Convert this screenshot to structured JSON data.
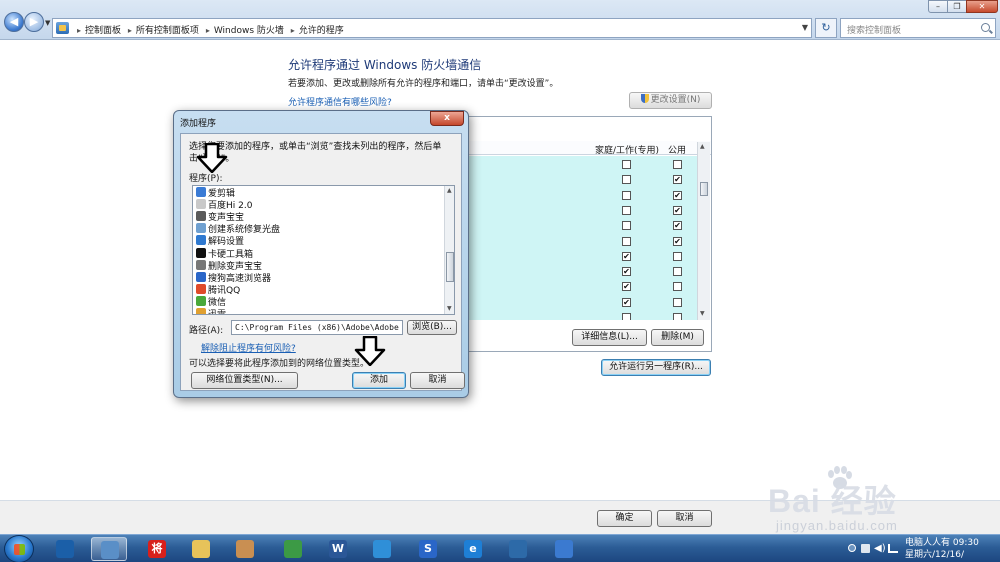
{
  "address_bar": {
    "crumbs": [
      "控制面板",
      "所有控制面板项",
      "Windows 防火墙",
      "允许的程序"
    ],
    "search_placeholder": "搜索控制面板"
  },
  "main": {
    "title": "允许程序通过 Windows 防火墙通信",
    "description": "若要添加、更改或删除所有允许的程序和端口，请单击“更改设置”。",
    "risk_link": "允许程序通信有哪些风险?",
    "change_settings_label": "更改设置(N)",
    "columns": {
      "home_work": "家庭/工作(专用)",
      "public": "公用"
    },
    "rows": [
      {
        "home": false,
        "public": false
      },
      {
        "home": false,
        "public": true
      },
      {
        "home": false,
        "public": true
      },
      {
        "home": false,
        "public": true
      },
      {
        "home": false,
        "public": true
      },
      {
        "home": false,
        "public": true
      },
      {
        "home": true,
        "public": false
      },
      {
        "home": true,
        "public": false
      },
      {
        "home": true,
        "public": false
      },
      {
        "home": true,
        "public": false
      },
      {
        "home": false,
        "public": false
      }
    ],
    "details_label": "详细信息(L)...",
    "delete_label": "删除(M)",
    "allow_other_label": "允许运行另一程序(R)..."
  },
  "dialog": {
    "title": "添加程序",
    "close_symbol": "x",
    "instruction": "选择您要添加的程序，或单击“浏览”查找未列出的程序，然后单击“确定”。",
    "programs_label": "程序(P):",
    "programs": [
      {
        "name": "爱剪辑",
        "icon_color": "#3a7bd5"
      },
      {
        "name": "百度Hi 2.0",
        "icon_color": "#c9c9c9"
      },
      {
        "name": "变声宝宝",
        "icon_color": "#5a5a5a"
      },
      {
        "name": "创建系统修复光盘",
        "icon_color": "#6fa0d0"
      },
      {
        "name": "解码设置",
        "icon_color": "#2f79d0"
      },
      {
        "name": "卡硬工具箱",
        "icon_color": "#111111"
      },
      {
        "name": "删除变声宝宝",
        "icon_color": "#777777"
      },
      {
        "name": "搜狗高速浏览器",
        "icon_color": "#2a66c8"
      },
      {
        "name": "腾讯QQ",
        "icon_color": "#e04b2a"
      },
      {
        "name": "微信",
        "icon_color": "#4aa83a"
      },
      {
        "name": "迅雷",
        "icon_color": "#e0a030"
      }
    ],
    "path_label": "路径(A):",
    "path_value": "C:\\Program Files (x86)\\Adobe\\Adobe Cr",
    "browse_label": "浏览(B)...",
    "block_risk_link": "解除阻止程序有何风险?",
    "network_desc": "可以选择要将此程序添加到的网络位置类型。",
    "network_type_label": "网络位置类型(N)...",
    "add_label": "添加",
    "cancel_label": "取消"
  },
  "footer": {
    "ok_label": "确定",
    "cancel_label": "取消"
  },
  "taskbar": {
    "items": [
      {
        "name": "show-desktop",
        "glyph": "",
        "color": "#1b5fa8"
      },
      {
        "name": "control-panel",
        "glyph": "",
        "color": "#5a8fc7",
        "active": true
      },
      {
        "name": "app-jiang",
        "glyph": "将",
        "color": "#d8201c"
      },
      {
        "name": "folder",
        "glyph": "",
        "color": "#e7c35a"
      },
      {
        "name": "paint",
        "glyph": "",
        "color": "#c98f52"
      },
      {
        "name": "chrome",
        "glyph": "",
        "color": "#3c9a45"
      },
      {
        "name": "word",
        "glyph": "W",
        "color": "#2b5797"
      },
      {
        "name": "app-blue",
        "glyph": "",
        "color": "#2f8fd8"
      },
      {
        "name": "sogou",
        "glyph": "S",
        "color": "#2a66c8"
      },
      {
        "name": "ie",
        "glyph": "e",
        "color": "#1e7fd6"
      },
      {
        "name": "remote-desktop",
        "glyph": "",
        "color": "#2d6aa8"
      },
      {
        "name": "media",
        "glyph": "",
        "color": "#3b7ad0"
      }
    ],
    "clock_line1": "电脑人人有 09:30",
    "clock_line2": "星期六/12/16/"
  },
  "watermark": {
    "logo": "Bai 经验",
    "url": "jingyan.baidu.com"
  }
}
